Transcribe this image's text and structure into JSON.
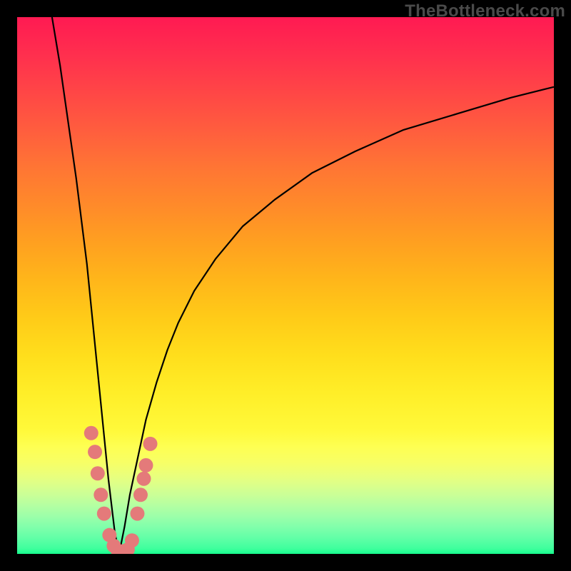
{
  "watermark": "TheBottleneck.com",
  "colors": {
    "frame": "#000000",
    "curve": "#000000",
    "dot": "#e47a7a",
    "gradient_top": "#ff1a52",
    "gradient_bottom": "#17ff8e"
  },
  "chart_data": {
    "type": "line",
    "title": "",
    "xlabel": "",
    "ylabel": "",
    "xlim": [
      0,
      100
    ],
    "ylim": [
      0,
      100
    ],
    "orientation": "y_down_is_bottom",
    "description": "Bottleneck-style V curve: steep left branch plunging to ~0% near x≈19, then rising branch flattening toward ~87% at x=100. Gradient background encodes vertical position (red=top/bad, green=bottom/good). Salmon dots mark highlighted points near the trough.",
    "series": [
      {
        "name": "left-branch",
        "x": [
          6.5,
          8,
          9,
          10,
          11,
          12,
          13,
          13.8,
          14.6,
          15.4,
          16.2,
          17,
          17.6,
          18.2,
          19
        ],
        "y": [
          100,
          91,
          84,
          77,
          70,
          62,
          54,
          46,
          38,
          30,
          22,
          14,
          9,
          4,
          0
        ]
      },
      {
        "name": "right-branch",
        "x": [
          19,
          20,
          21,
          22.5,
          24,
          26,
          28,
          30,
          33,
          37,
          42,
          48,
          55,
          63,
          72,
          82,
          92,
          100
        ],
        "y": [
          0,
          5,
          11,
          18,
          25,
          32,
          38,
          43,
          49,
          55,
          61,
          66,
          71,
          75,
          79,
          82,
          85,
          87
        ]
      }
    ],
    "dots": [
      {
        "x": 13.8,
        "y": 22.5
      },
      {
        "x": 14.5,
        "y": 19
      },
      {
        "x": 15.0,
        "y": 15
      },
      {
        "x": 15.6,
        "y": 11
      },
      {
        "x": 16.2,
        "y": 7.5
      },
      {
        "x": 17.2,
        "y": 3.5
      },
      {
        "x": 18.0,
        "y": 1.5
      },
      {
        "x": 18.8,
        "y": 0.5
      },
      {
        "x": 19.8,
        "y": 0.5
      },
      {
        "x": 20.6,
        "y": 0.8
      },
      {
        "x": 21.4,
        "y": 2.5
      },
      {
        "x": 22.4,
        "y": 7.5
      },
      {
        "x": 23.0,
        "y": 11
      },
      {
        "x": 23.6,
        "y": 14
      },
      {
        "x": 24.0,
        "y": 16.5
      },
      {
        "x": 24.8,
        "y": 20.5
      }
    ]
  }
}
